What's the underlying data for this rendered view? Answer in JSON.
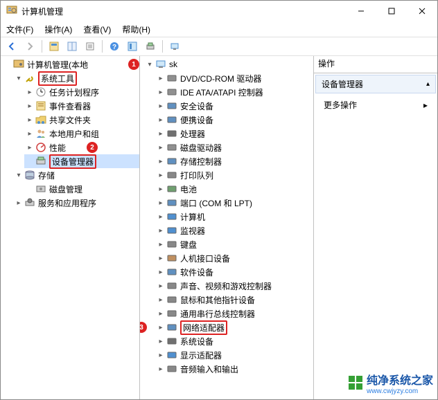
{
  "window": {
    "title": "计算机管理"
  },
  "menu": {
    "file": "文件(F)",
    "action": "操作(A)",
    "view": "查看(V)",
    "help": "帮助(H)"
  },
  "left_tree": {
    "root": "计算机管理(本地",
    "system_tools": "系统工具",
    "task_scheduler": "任务计划程序",
    "event_viewer": "事件查看器",
    "shared_folders": "共享文件夹",
    "local_users": "本地用户和组",
    "performance": "性能",
    "device_manager": "设备管理器",
    "storage": "存储",
    "disk_mgmt": "磁盘管理",
    "services_apps": "服务和应用程序"
  },
  "mid_tree": {
    "root": "sk",
    "items": [
      "DVD/CD-ROM 驱动器",
      "IDE ATA/ATAPI 控制器",
      "安全设备",
      "便携设备",
      "处理器",
      "磁盘驱动器",
      "存储控制器",
      "打印队列",
      "电池",
      "端口 (COM 和 LPT)",
      "计算机",
      "监视器",
      "键盘",
      "人机接口设备",
      "软件设备",
      "声音、视频和游戏控制器",
      "鼠标和其他指针设备",
      "通用串行总线控制器",
      "网络适配器",
      "系统设备",
      "显示适配器",
      "音频输入和输出"
    ]
  },
  "right": {
    "header": "操作",
    "section": "设备管理器",
    "more": "更多操作"
  },
  "badges": {
    "b1": "1",
    "b2": "2",
    "b3": "3"
  },
  "watermark": {
    "big": "纯净系统之家",
    "small": "www.cwjyzy.com"
  },
  "chevron": "▸"
}
